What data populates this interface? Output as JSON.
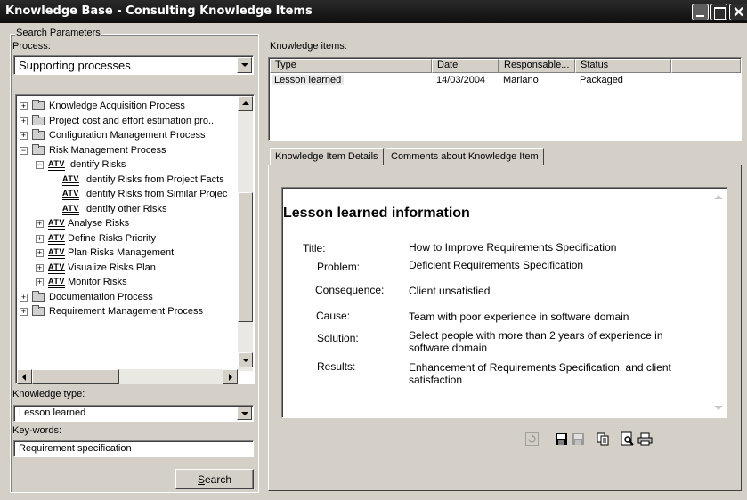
{
  "window": {
    "title": "Knowledge Base - Consulting Knowledge Items"
  },
  "search": {
    "group_title": "Search Parameters",
    "process_label": "Process:",
    "process_value": "Supporting processes",
    "tree": [
      {
        "label": "Knowledge Acquisition Process",
        "type": "folder",
        "level": 0,
        "expander": "+"
      },
      {
        "label": "Project cost and effort estimation pro..",
        "type": "folder",
        "level": 0,
        "expander": "+"
      },
      {
        "label": "Configuration Management Process",
        "type": "folder",
        "level": 0,
        "expander": "+"
      },
      {
        "label": "Risk Management Process",
        "type": "folder",
        "level": 0,
        "expander": "-"
      },
      {
        "label": "Identify Risks",
        "type": "activity",
        "level": 1,
        "expander": "-"
      },
      {
        "label": "Identify Risks from Project Facts",
        "type": "activity",
        "level": 2,
        "expander": ""
      },
      {
        "label": "Identify Risks from Similar Projec",
        "type": "activity",
        "level": 2,
        "expander": ""
      },
      {
        "label": "Identify other Risks",
        "type": "activity",
        "level": 2,
        "expander": ""
      },
      {
        "label": "Analyse Risks",
        "type": "activity",
        "level": 1,
        "expander": "+"
      },
      {
        "label": "Define Risks Priority",
        "type": "activity",
        "level": 1,
        "expander": "+"
      },
      {
        "label": "Plan Risks Management",
        "type": "activity",
        "level": 1,
        "expander": "+"
      },
      {
        "label": "Visualize Risks Plan",
        "type": "activity",
        "level": 1,
        "expander": "+"
      },
      {
        "label": "Monitor Risks",
        "type": "activity",
        "level": 1,
        "expander": "+"
      },
      {
        "label": "Documentation Process",
        "type": "folder",
        "level": 0,
        "expander": "+"
      },
      {
        "label": "Requirement Management Process",
        "type": "folder",
        "level": 0,
        "expander": "+"
      }
    ],
    "activity_badge": "ATV",
    "knowledge_type_label": "Knowledge type:",
    "knowledge_type_value": "Lesson learned",
    "keywords_label": "Key-words:",
    "keywords_value": "Requirement specification",
    "search_button_prefix": "",
    "search_button_underlined": "S",
    "search_button_rest": "earch"
  },
  "items": {
    "label": "Knowledge items:",
    "columns": [
      "Type",
      "Date",
      "Responsable...",
      "Status"
    ],
    "rows": [
      {
        "type": "Lesson learned",
        "date": "14/03/2004",
        "responsible": "Mariano",
        "status": "Packaged"
      }
    ]
  },
  "tabs": [
    {
      "label": "Knowledge Item Details",
      "active": true
    },
    {
      "label": "Comments about Knowledge Item",
      "active": false
    }
  ],
  "details": {
    "heading": "Lesson learned information",
    "fields": [
      {
        "label": "Title:",
        "value": "How to Improve Requirements Specification"
      },
      {
        "label": "Problem:",
        "value": "Deficient Requirements Specification"
      },
      {
        "label": "Consequence:",
        "value": "Client unsatisfied"
      },
      {
        "label": "Cause:",
        "value": "Team with poor experience in software domain"
      },
      {
        "label": "Solution:",
        "value": "Select people with more than 2 years of experience in software domain"
      },
      {
        "label": "Results:",
        "value": "Enhancement of Requirements Specification, and client satisfaction"
      }
    ]
  },
  "toolbar": [
    "refresh-icon",
    "save-icon",
    "save-all-icon",
    "copy-icon",
    "print-preview-icon",
    "print-icon"
  ],
  "colors": {
    "titlebar": "#1a1a1a",
    "face": "#d4d0c8",
    "selection": "#e8e8e8"
  }
}
